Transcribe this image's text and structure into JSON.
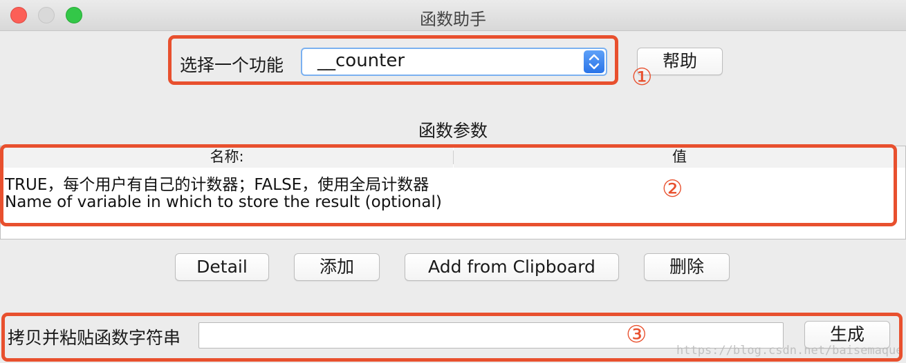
{
  "window": {
    "title": "函数助手"
  },
  "function_select": {
    "label": "选择一个功能",
    "value": "__counter"
  },
  "help_button": "帮助",
  "params_section_title": "函数参数",
  "params_table": {
    "columns": [
      "名称:",
      "值"
    ],
    "rows": [
      {
        "name": "TRUE，每个用户有自己的计数器；FALSE，使用全局计数器",
        "value": ""
      },
      {
        "name": "Name of variable in which to store the result (optional)",
        "value": ""
      }
    ]
  },
  "table_buttons": {
    "detail": "Detail",
    "add": "添加",
    "add_from_clipboard": "Add from Clipboard",
    "delete": "删除"
  },
  "result": {
    "label": "拷贝并粘贴函数字符串",
    "value": "",
    "generate_button": "生成"
  },
  "annotations": [
    "①",
    "②",
    "③"
  ],
  "watermark": "https://blog.csdn.net/baisemaque",
  "colors": {
    "annotation": "#e8502e",
    "select_focus": "#7ab0f0",
    "select_arrow": "#2a74e8",
    "close": "#fc5f57",
    "maximize": "#33c748"
  }
}
